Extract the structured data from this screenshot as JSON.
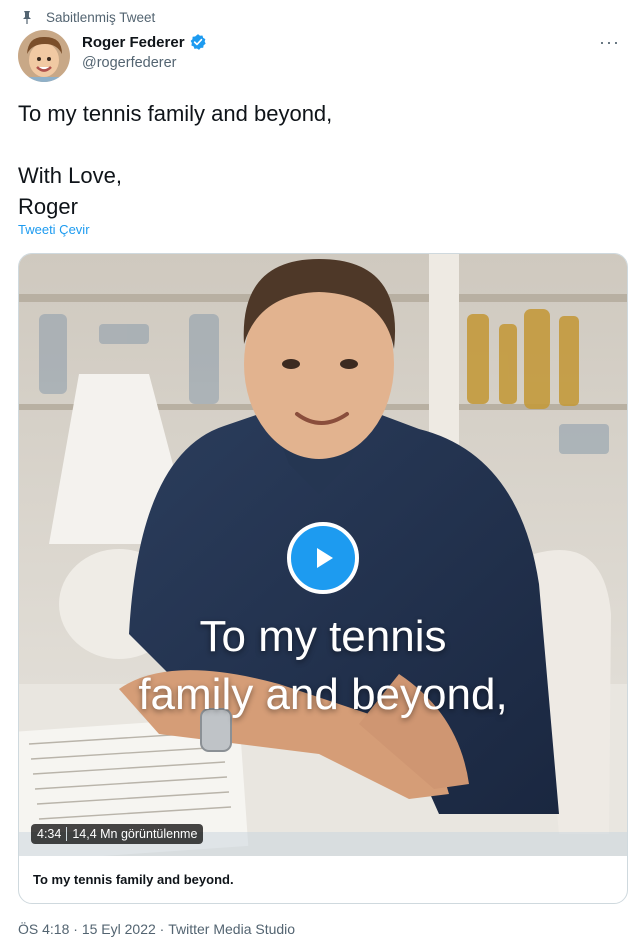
{
  "pinned": {
    "label": "Sabitlenmiş Tweet",
    "icon": "pin-icon"
  },
  "author": {
    "name": "Roger Federer",
    "handle": "@rogerfederer",
    "verified_icon": "verified-badge-icon",
    "avatar": "avatar"
  },
  "more_icon": "more-options-icon",
  "tweet": {
    "text": "To my tennis family and beyond,\n\nWith Love,\nRoger",
    "translate_label": "Tweeti Çevir"
  },
  "media": {
    "caption_line1": "To my tennis",
    "caption_line2": "family and beyond,",
    "duration": "4:34",
    "views": "14,4 Mn görüntülenme",
    "title": "To my tennis family and beyond.",
    "play_icon": "play-icon"
  },
  "meta": {
    "time": "ÖS 4:18",
    "separator": " · ",
    "date": "15 Eyl 2022",
    "source": "Twitter Media Studio"
  },
  "colors": {
    "accent": "#1d9bf0",
    "text": "#0f1419",
    "secondary": "#536471",
    "border": "#cfd9de"
  }
}
